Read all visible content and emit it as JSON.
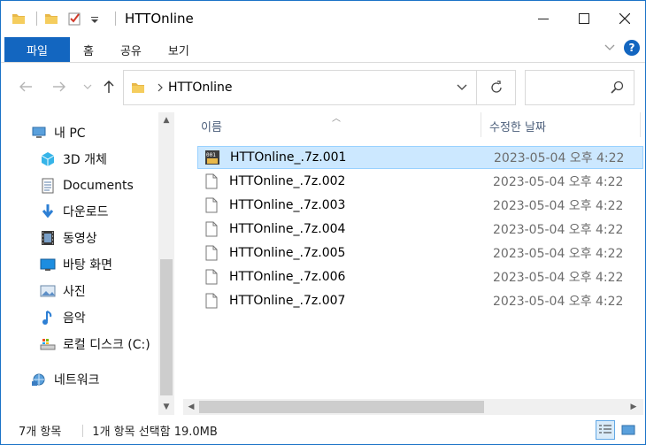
{
  "window": {
    "title": "HTTOnline"
  },
  "ribbon": {
    "tabs": [
      "파일",
      "홈",
      "공유",
      "보기"
    ],
    "help_label": "?"
  },
  "address": {
    "path_label": "HTTOnline"
  },
  "nav": {
    "items": [
      {
        "label": "내 PC",
        "icon": "pc-icon"
      },
      {
        "label": "3D 개체",
        "icon": "3d-objects-icon"
      },
      {
        "label": "Documents",
        "icon": "documents-icon"
      },
      {
        "label": "다운로드",
        "icon": "download-icon"
      },
      {
        "label": "동영상",
        "icon": "video-icon"
      },
      {
        "label": "바탕 화면",
        "icon": "desktop-icon"
      },
      {
        "label": "사진",
        "icon": "pictures-icon"
      },
      {
        "label": "음악",
        "icon": "music-icon"
      },
      {
        "label": "로컬 디스크 (C:)",
        "icon": "drive-icon"
      },
      {
        "label": "네트워크",
        "icon": "network-icon"
      }
    ]
  },
  "columns": {
    "name": "이름",
    "date": "수정한 날짜"
  },
  "files": [
    {
      "name": "HTTOnline_.7z.001",
      "date": "2023-05-04 오후 4:22",
      "selected": true
    },
    {
      "name": "HTTOnline_.7z.002",
      "date": "2023-05-04 오후 4:22"
    },
    {
      "name": "HTTOnline_.7z.003",
      "date": "2023-05-04 오후 4:22"
    },
    {
      "name": "HTTOnline_.7z.004",
      "date": "2023-05-04 오후 4:22"
    },
    {
      "name": "HTTOnline_.7z.005",
      "date": "2023-05-04 오후 4:22"
    },
    {
      "name": "HTTOnline_.7z.006",
      "date": "2023-05-04 오후 4:22"
    },
    {
      "name": "HTTOnline_.7z.007",
      "date": "2023-05-04 오후 4:22"
    }
  ],
  "selected_file_badge": "001",
  "status": {
    "item_count": "7개 항목",
    "selection": "1개 항목 선택함 19.0MB"
  },
  "colors": {
    "accent": "#1366c0",
    "selection_bg": "#cce8ff",
    "folder": "#e8b84a"
  }
}
